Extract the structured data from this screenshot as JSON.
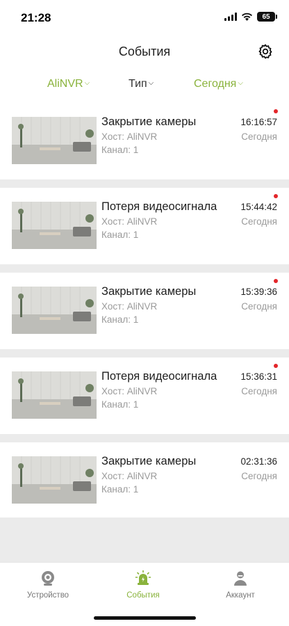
{
  "status_bar": {
    "time": "21:28",
    "battery": "65"
  },
  "header": {
    "title": "События",
    "settings_icon": "gear-icon"
  },
  "filters": [
    {
      "label": "AliNVR",
      "color": "#8ab33c"
    },
    {
      "label": "Тип",
      "color": "#333333"
    },
    {
      "label": "Сегодня",
      "color": "#8ab33c"
    }
  ],
  "events": [
    {
      "title": "Закрытие камеры",
      "host": "Хост:  AliNVR",
      "channel": "Канал:  1",
      "time": "16:16:57",
      "date": "Сегодня",
      "unread": true
    },
    {
      "title": "Потеря видеосигнала",
      "host": "Хост:  AliNVR",
      "channel": "Канал:  1",
      "time": "15:44:42",
      "date": "Сегодня",
      "unread": true
    },
    {
      "title": "Закрытие камеры",
      "host": "Хост:  AliNVR",
      "channel": "Канал:  1",
      "time": "15:39:36",
      "date": "Сегодня",
      "unread": true
    },
    {
      "title": "Потеря видеосигнала",
      "host": "Хост:  AliNVR",
      "channel": "Канал:  1",
      "time": "15:36:31",
      "date": "Сегодня",
      "unread": true
    },
    {
      "title": "Закрытие камеры",
      "host": "Хост:  AliNVR",
      "channel": "Канал:  1",
      "time": "02:31:36",
      "date": "Сегодня",
      "unread": false
    }
  ],
  "tabbar": {
    "tabs": [
      {
        "label": "Устройство",
        "icon": "camera-icon",
        "active": false
      },
      {
        "label": "События",
        "icon": "alarm-light-icon",
        "active": true
      },
      {
        "label": "Аккаунт",
        "icon": "person-icon",
        "active": false
      }
    ]
  },
  "colors": {
    "accent": "#8ab33c",
    "unread": "#e3262a",
    "divider": "#ebebeb"
  }
}
